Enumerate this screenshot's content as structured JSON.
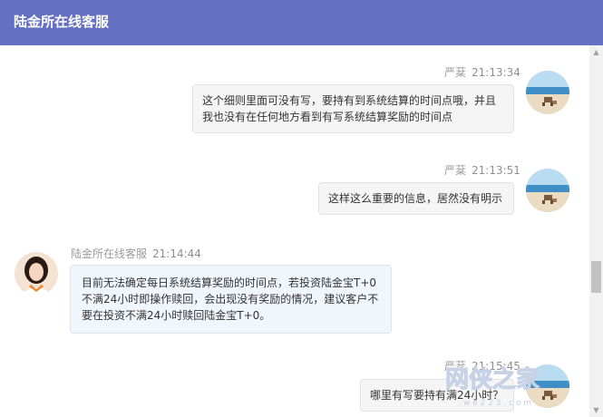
{
  "header": {
    "title": "陆金所在线客服"
  },
  "colors": {
    "header_bg": "#6470c2",
    "user_bubble": "#f5f5f5",
    "agent_bubble": "#f1f6fd"
  },
  "messages": [
    {
      "sender": "严棻",
      "time": "21:13:34",
      "role": "user",
      "lines": [
        "这个细则里面可没有写，要持有到系统结算的时间点哦，并且",
        "我也没有在任何地方看到有写系统结算奖励的时间点"
      ]
    },
    {
      "sender": "严棻",
      "time": "21:13:51",
      "role": "user",
      "lines": [
        "这样这么重要的信息，居然没有明示"
      ]
    },
    {
      "sender": "陆金所在线客服",
      "time": "21:14:44",
      "role": "agent",
      "lines": [
        "目前无法确定每日系统结算奖励的时间点，若投资陆金宝T+0",
        "不满24小时即操作赎回，会出现没有奖励的情况，建议客户不",
        "要在投资不满24小时赎回陆金宝T+0。"
      ]
    },
    {
      "sender": "严棻",
      "time": "21:15:45",
      "role": "user",
      "lines": [
        "哪里有写要持有满24小时？"
      ]
    }
  ],
  "watermark": {
    "text": "网侠之家",
    "sub": "w e 2 2 3 . c o m"
  },
  "icons": {
    "user_avatar": "beach-avatar-icon",
    "agent_avatar": "agent-avatar-icon"
  }
}
